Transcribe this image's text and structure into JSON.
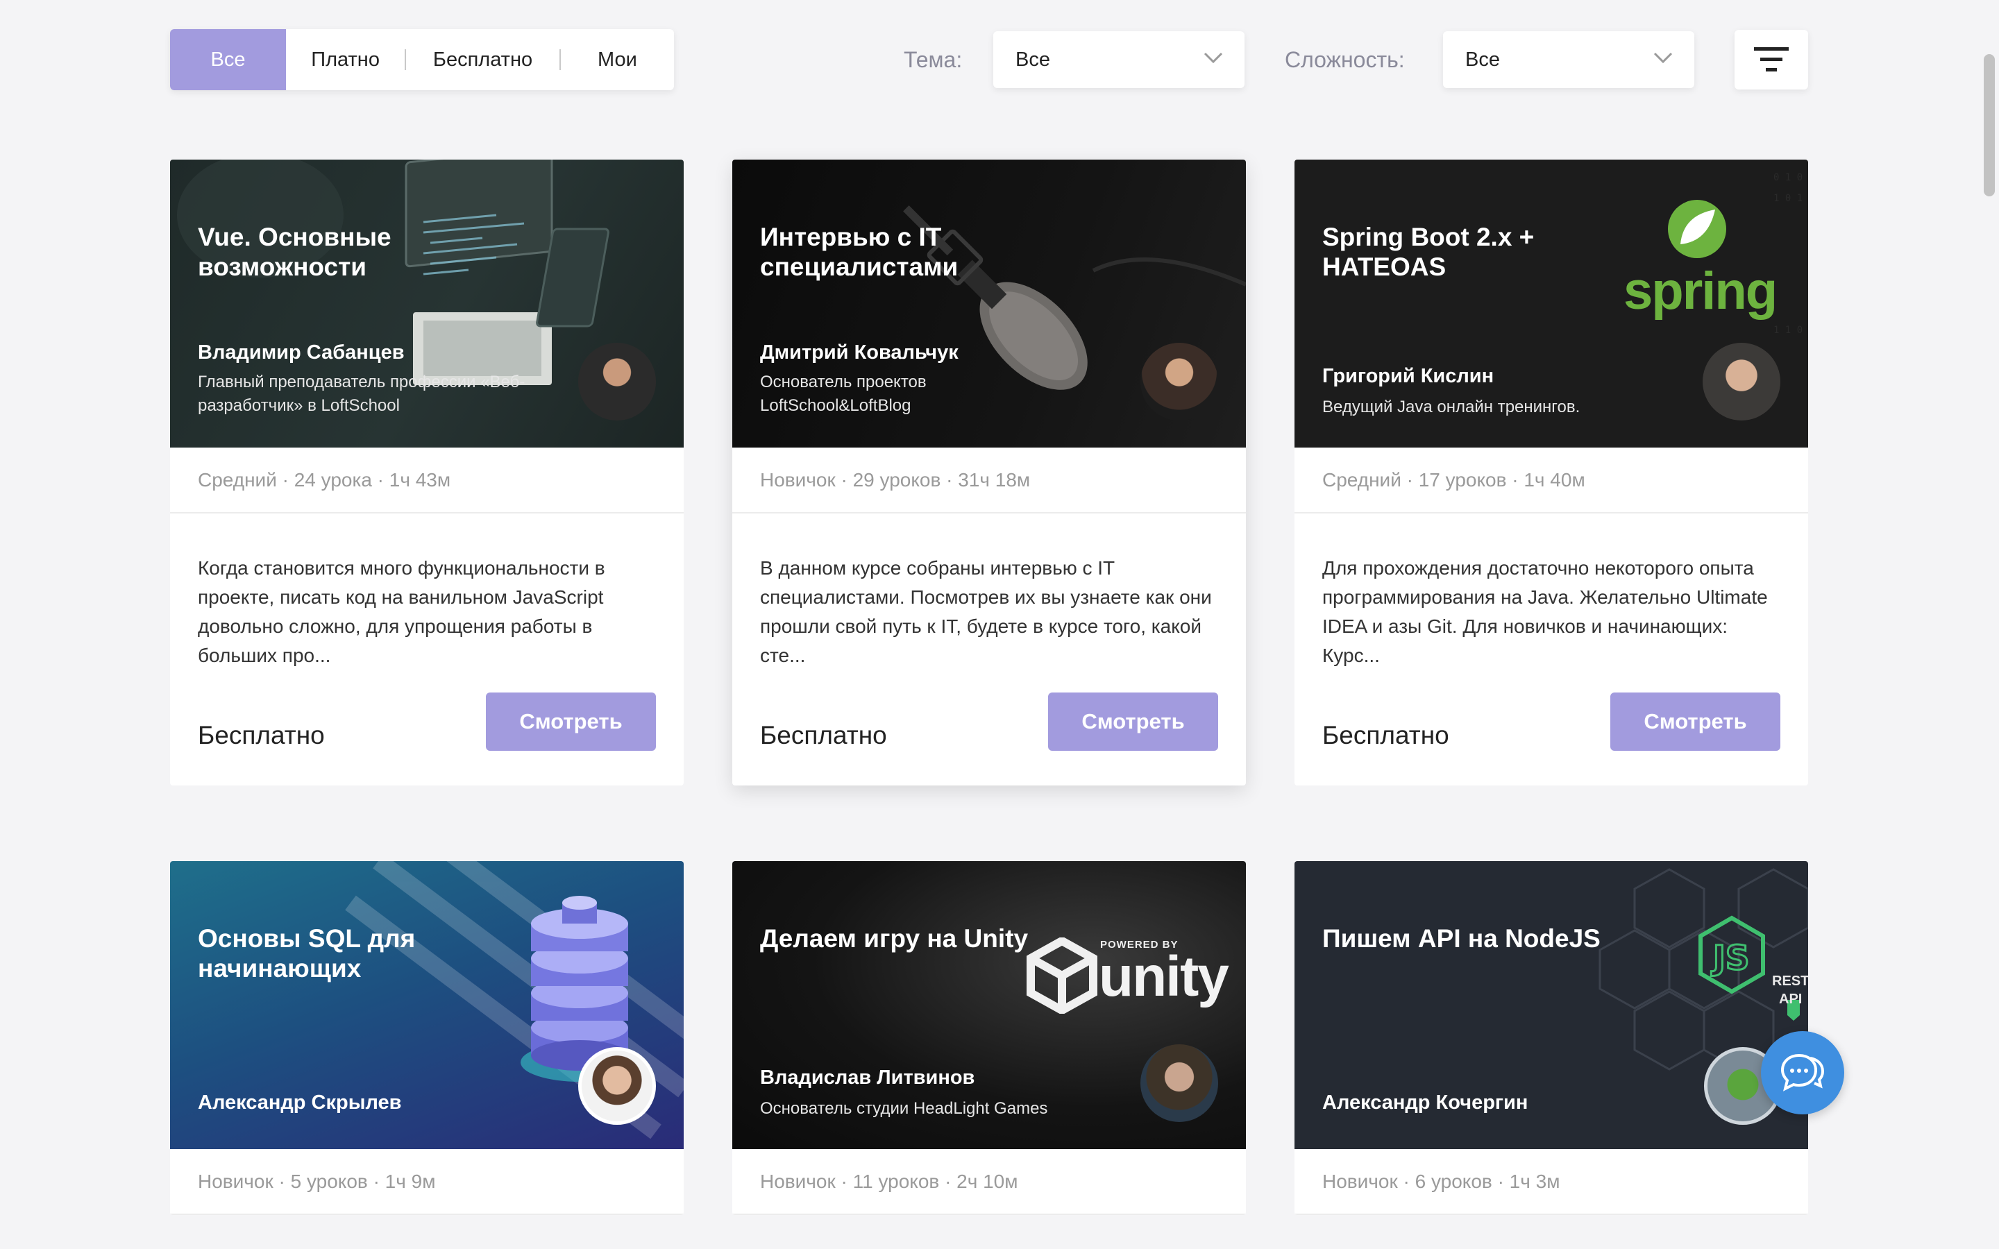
{
  "filters": {
    "tabs": [
      "Все",
      "Платно",
      "Бесплатно",
      "Мои"
    ],
    "topic_label": "Тема:",
    "topic_value": "Все",
    "difficulty_label": "Сложность:",
    "difficulty_value": "Все"
  },
  "cards": [
    {
      "title": "Vue. Основные возможности",
      "author": "Владимир Сабанцев",
      "role": "Главный преподаватель профессии «Веб-разработчик» в LoftSchool",
      "meta": "Средний · 24 урока · 1ч 43м",
      "description": "Когда становится много функциональности в проекте, писать код на ванильном JavaScript довольно сложно, для упрощения работы в больших про...",
      "price": "Бесплатно",
      "button": "Смотреть"
    },
    {
      "title": "Интервью с IT специалистами",
      "author": "Дмитрий Ковальчук",
      "role": "Основатель проектов LoftSchool&LoftBlog",
      "meta": "Новичок · 29 уроков · 31ч 18м",
      "description": "В данном курсе собраны интервью с IT специалистами. Посмотрев их вы узнаете как они прошли свой путь к IT, будете в курсе того, какой сте...",
      "price": "Бесплатно",
      "button": "Смотреть"
    },
    {
      "title": "Spring Boot 2.x + HATEOAS",
      "author": "Григорий Кислин",
      "role": "Ведущий Java онлайн тренингов.",
      "meta": "Средний · 17 уроков · 1ч 40м",
      "description": "Для прохождения достаточно некоторого опыта программирования на Java. Желательно Ultimate IDEA и азы Git. Для новичков и начинающих: Курс...",
      "price": "Бесплатно",
      "button": "Смотреть",
      "logo_text": "spring"
    },
    {
      "title": "Основы SQL для начинающих",
      "author": "Александр Скрылев",
      "role": "",
      "meta": "Новичок · 5 уроков · 1ч 9м"
    },
    {
      "title": "Делаем игру на Unity",
      "author": "Владислав Литвинов",
      "role": "Основатель студии HeadLight Games",
      "meta": "Новичок · 11 уроков · 2ч 10м",
      "logo_small": "POWERED BY",
      "logo_text": "unity"
    },
    {
      "title": "Пишем API на NodeJS",
      "author": "Александр Кочергин",
      "role": "",
      "meta": "Новичок · 6 уроков · 1ч 3м",
      "badge_line1": "REST",
      "badge_line2": "API"
    }
  ],
  "colors": {
    "accent": "#a29bde",
    "chat": "#3f8fe0",
    "background": "#f4f4f6"
  },
  "icons": [
    "chevron-down-icon",
    "filter-icon",
    "chat-icon",
    "spring-leaf-icon",
    "unity-logo-icon",
    "nodejs-icon",
    "database-icon",
    "microphone-icon"
  ]
}
